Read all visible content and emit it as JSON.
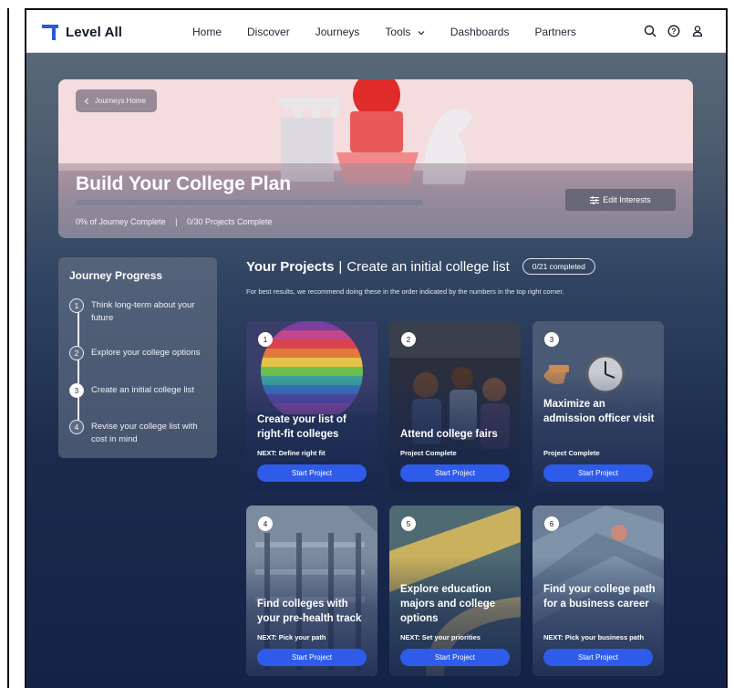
{
  "nav": {
    "logo": "Level All",
    "links": [
      "Home",
      "Discover",
      "Journeys",
      "Tools",
      "Dashboards",
      "Partners"
    ]
  },
  "hero": {
    "back_label": "Journeys Home",
    "title": "Build Your College Plan",
    "journey_complete": "0% of Journey Complete",
    "projects_complete": "0/30 Projects Complete",
    "progress_fraction": 0.0,
    "edit_label": "Edit Interests"
  },
  "journey": {
    "heading": "Journey Progress",
    "steps": [
      {
        "num": "1",
        "label": "Think long-term about your future"
      },
      {
        "num": "2",
        "label": "Explore your college options"
      },
      {
        "num": "3",
        "label": "Create an initial college list"
      },
      {
        "num": "4",
        "label": "Revise your college list with cost in mind"
      }
    ]
  },
  "projects": {
    "heading": "Your Projects",
    "separator": "|",
    "subtitle": "Create an initial college list",
    "badge": "0/21 completed",
    "hint": "For best results, we recommend doing these in the order indicated by the numbers in the top right corner.",
    "cards": [
      {
        "num": "1",
        "title": "Create your list of right-fit colleges",
        "next": "NEXT: Define right fit",
        "button": "Start Project"
      },
      {
        "num": "2",
        "title": "Attend college fairs",
        "next": "Project Complete",
        "button": "Start Project"
      },
      {
        "num": "3",
        "title": "Maximize an admission officer visit",
        "next": "Project Complete",
        "button": "Start Project"
      },
      {
        "num": "4",
        "title": "Find colleges with your pre-health track",
        "next": "NEXT: Pick your path",
        "button": "Start Project"
      },
      {
        "num": "5",
        "title": "Explore education majors and college options",
        "next": "NEXT: Set your priorities",
        "button": "Start Project"
      },
      {
        "num": "6",
        "title": "Find your college path for a business career",
        "next": "NEXT: Pick your business path",
        "button": "Start Project"
      }
    ]
  },
  "colors": {
    "accent": "#2f5bea",
    "logo": "#2b5bd7",
    "nav_bg": "#ffffff",
    "page_bg_dark": "#132247"
  },
  "icons": [
    "search-icon",
    "help-icon",
    "user-icon",
    "chevron-down-icon",
    "chevron-left-icon",
    "sliders-icon"
  ]
}
